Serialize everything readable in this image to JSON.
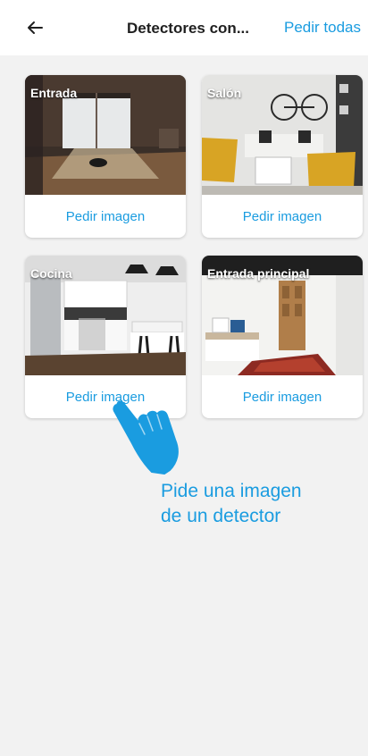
{
  "header": {
    "back_icon": "arrow-left-icon",
    "title": "Detectores con...",
    "request_all_label": "Pedir todas"
  },
  "detectors": [
    {
      "name": "Entrada",
      "action_label": "Pedir imagen"
    },
    {
      "name": "Salón",
      "action_label": "Pedir imagen"
    },
    {
      "name": "Cocina",
      "action_label": "Pedir imagen"
    },
    {
      "name": "Entrada principal",
      "action_label": "Pedir imagen"
    }
  ],
  "hint": {
    "line1": "Pide una imagen",
    "line2": "de un detector",
    "icon": "pointing-hand-icon"
  },
  "colors": {
    "accent": "#1a9ce0",
    "background": "#f2f2f2",
    "card": "#ffffff"
  }
}
